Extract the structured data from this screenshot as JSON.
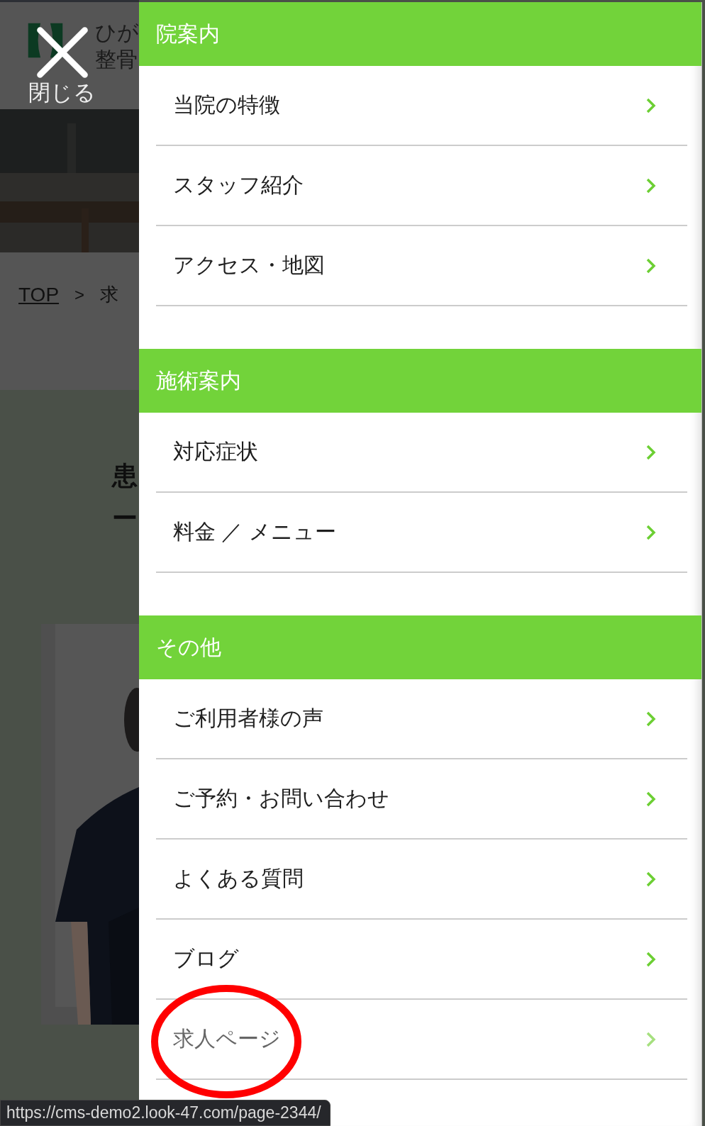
{
  "header": {
    "logo_lines": [
      "ひが",
      "整骨"
    ]
  },
  "close_button": {
    "label": "閉じる"
  },
  "breadcrumb": {
    "link": "TOP",
    "separator": ">",
    "current": "求"
  },
  "heading": [
    "患",
    "ー"
  ],
  "menu": {
    "sections": [
      {
        "title": "院案内",
        "items": [
          {
            "label": "当院の特徴",
            "hovered": false,
            "circled": false
          },
          {
            "label": "スタッフ紹介",
            "hovered": false,
            "circled": false
          },
          {
            "label": "アクセス・地図",
            "hovered": false,
            "circled": false
          }
        ]
      },
      {
        "title": "施術案内",
        "items": [
          {
            "label": "対応症状",
            "hovered": false,
            "circled": false
          },
          {
            "label": "料金 ／ メニュー",
            "hovered": false,
            "circled": false
          }
        ]
      },
      {
        "title": "その他",
        "items": [
          {
            "label": "ご利用者様の声",
            "hovered": false,
            "circled": false
          },
          {
            "label": "ご予約・お問い合わせ",
            "hovered": false,
            "circled": false
          },
          {
            "label": "よくある質問",
            "hovered": false,
            "circled": false
          },
          {
            "label": "ブログ",
            "hovered": false,
            "circled": false
          },
          {
            "label": "求人ページ",
            "hovered": true,
            "circled": true
          }
        ]
      }
    ]
  },
  "status_bar": {
    "url": "https://cms-demo2.look-47.com/page-2344/"
  }
}
